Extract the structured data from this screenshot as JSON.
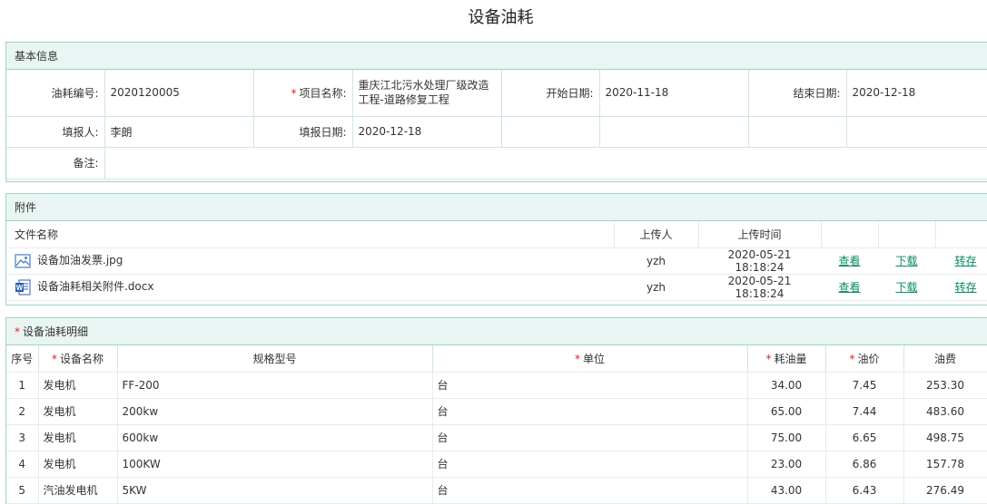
{
  "page_title": "设备油耗",
  "basic": {
    "header": "基本信息",
    "code_label": "油耗编号:",
    "code_value": "2020120005",
    "project_label": "项目名称:",
    "project_value": "重庆江北污水处理厂级改造工程-道路修复工程",
    "start_label": "开始日期:",
    "start_value": "2020-11-18",
    "end_label": "结束日期:",
    "end_value": "2020-12-18",
    "reporter_label": "填报人:",
    "reporter_value": "李朗",
    "report_date_label": "填报日期:",
    "report_date_value": "2020-12-18",
    "remark_label": "备注:",
    "remark_value": ""
  },
  "attachments": {
    "header": "附件",
    "col_name": "文件名称",
    "col_uploader": "上传人",
    "col_time": "上传时间",
    "files": [
      {
        "name": "设备加油发票.jpg",
        "icon": "image-file-icon",
        "uploader": "yzh",
        "time": "2020-05-21 18:18:24",
        "view": "查看",
        "download": "下载",
        "save": "转存"
      },
      {
        "name": "设备油耗相关附件.docx",
        "icon": "word-file-icon",
        "uploader": "yzh",
        "time": "2020-05-21 18:18:24",
        "view": "查看",
        "download": "下载",
        "save": "转存"
      }
    ]
  },
  "detail": {
    "header": "设备油耗明细",
    "columns": {
      "no": "序号",
      "name": "设备名称",
      "spec": "规格型号",
      "unit": "单位",
      "fuel": "耗油量",
      "price": "油价",
      "cost": "油费"
    },
    "rows": [
      {
        "no": "1",
        "name": "发电机",
        "spec": "FF-200",
        "unit": "台",
        "fuel": "34.00",
        "price": "7.45",
        "cost": "253.30"
      },
      {
        "no": "2",
        "name": "发电机",
        "spec": "200kw",
        "unit": "台",
        "fuel": "65.00",
        "price": "7.44",
        "cost": "483.60"
      },
      {
        "no": "3",
        "name": "发电机",
        "spec": "600kw",
        "unit": "台",
        "fuel": "75.00",
        "price": "6.65",
        "cost": "498.75"
      },
      {
        "no": "4",
        "name": "发电机",
        "spec": "100KW",
        "unit": "台",
        "fuel": "23.00",
        "price": "6.86",
        "cost": "157.78"
      },
      {
        "no": "5",
        "name": "汽油发电机",
        "spec": "5KW",
        "unit": "台",
        "fuel": "43.00",
        "price": "6.43",
        "cost": "276.49"
      }
    ]
  }
}
